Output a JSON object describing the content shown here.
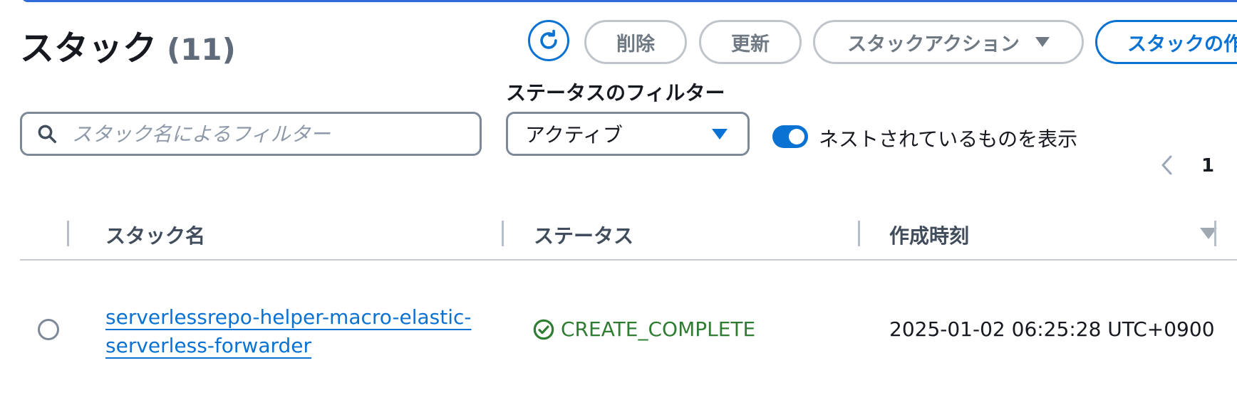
{
  "header": {
    "title": "スタック",
    "count": "(11)"
  },
  "toolbar": {
    "refresh_icon": "refresh-icon",
    "delete_label": "削除",
    "update_label": "更新",
    "actions_label": "スタックアクション",
    "create_label": "スタックの作成"
  },
  "filters": {
    "search_placeholder": "スタック名によるフィルター",
    "status_label": "ステータスのフィルター",
    "status_value": "アクティブ",
    "nested_label": "ネストされているものを表示",
    "nested_enabled": true
  },
  "pagination": {
    "current_page": "1"
  },
  "table": {
    "columns": [
      "スタック名",
      "ステータス",
      "作成時刻"
    ],
    "rows": [
      {
        "name": "serverlessrepo-helper-macro-elastic-serverless-forwarder",
        "status": "CREATE_COMPLETE",
        "created": "2025-01-02 06:25:28 UTC+0900"
      }
    ]
  },
  "colors": {
    "accent": "#0972d3",
    "success": "#2e7d32",
    "border": "#7d8998"
  }
}
